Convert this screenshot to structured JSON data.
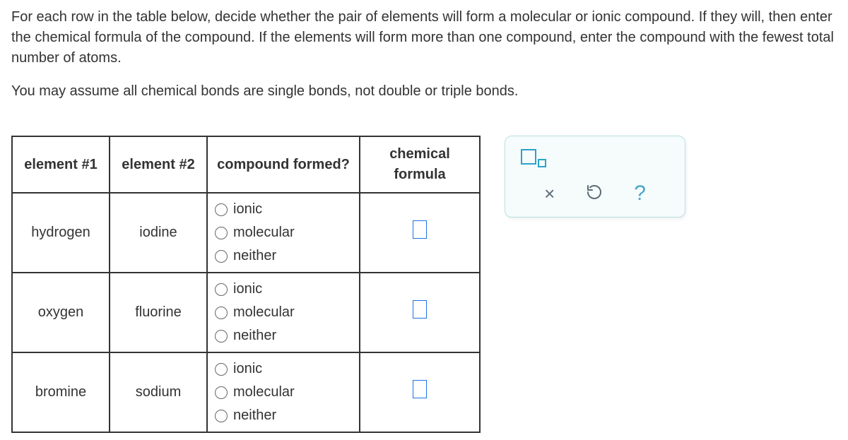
{
  "instructions": {
    "p1": "For each row in the table below, decide whether the pair of elements will form a molecular or ionic compound. If they will, then enter the chemical formula of the compound. If the elements will form more than one compound, enter the compound with the fewest total number of atoms.",
    "p2": "You may assume all chemical bonds are single bonds, not double or triple bonds."
  },
  "table": {
    "headers": {
      "el1": "element #1",
      "el2": "element #2",
      "comp": "compound formed?",
      "chem": "chemical formula"
    },
    "options": {
      "ionic": "ionic",
      "molecular": "molecular",
      "neither": "neither"
    },
    "rows": [
      {
        "el1": "hydrogen",
        "el2": "iodine"
      },
      {
        "el1": "oxygen",
        "el2": "fluorine"
      },
      {
        "el1": "bromine",
        "el2": "sodium"
      }
    ]
  },
  "tools": {
    "subscript": "subscript-toggle",
    "clear": "×",
    "reset": "↺",
    "help": "?"
  }
}
